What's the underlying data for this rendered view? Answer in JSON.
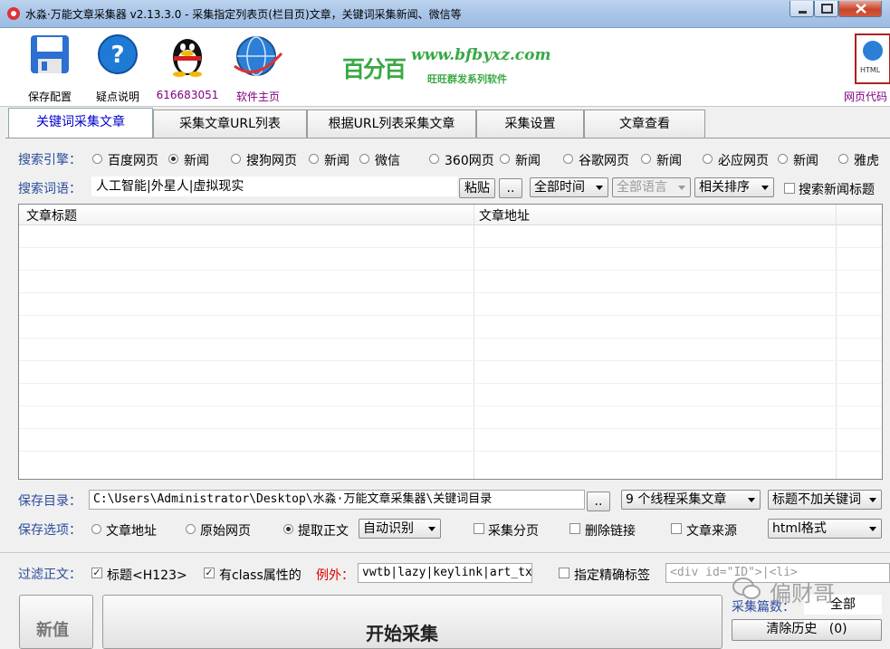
{
  "window": {
    "title": "水淼·万能文章采集器 v2.13.3.0 - 采集指定列表页(栏目页)文章，关键词采集新闻、微信等"
  },
  "toolbar": {
    "save_config": "保存配置",
    "help": "疑点说明",
    "qq": "616683051",
    "homepage": "软件主页",
    "logo_big": "百分百",
    "logo_url": "www.bfbyxz.com",
    "logo_sub": "旺旺群发系列软件",
    "html_label": "HTML",
    "web_code": "网页代码"
  },
  "tabs": [
    {
      "label": "关键词采集文章",
      "active": true
    },
    {
      "label": "采集文章URL列表",
      "active": false
    },
    {
      "label": "根据URL列表采集文章",
      "active": false
    },
    {
      "label": "采集设置",
      "active": false
    },
    {
      "label": "文章查看",
      "active": false
    }
  ],
  "search_engine": {
    "label": "搜索引擎：",
    "options": [
      {
        "label": "百度网页",
        "selected": false
      },
      {
        "label": "新闻",
        "selected": true
      },
      {
        "label": "搜狗网页",
        "selected": false
      },
      {
        "label": "新闻",
        "selected": false
      },
      {
        "label": "微信",
        "selected": false
      },
      {
        "label": "360网页",
        "selected": false
      },
      {
        "label": "新闻",
        "selected": false
      },
      {
        "label": "谷歌网页",
        "selected": false
      },
      {
        "label": "新闻",
        "selected": false
      },
      {
        "label": "必应网页",
        "selected": false
      },
      {
        "label": "新闻",
        "selected": false
      },
      {
        "label": "雅虎",
        "selected": false
      }
    ]
  },
  "search_terms": {
    "label": "搜索词语：",
    "value": "人工智能|外星人|虚拟现实",
    "paste": "粘贴",
    "more": "..",
    "time": "全部时间",
    "language": "全部语言",
    "sort": "相关排序",
    "news_title": "搜索新闻标题"
  },
  "list": {
    "columns": [
      "文章标题",
      "文章地址"
    ],
    "rows": []
  },
  "save_dir": {
    "label": "保存目录：",
    "value": "C:\\Users\\Administrator\\Desktop\\水淼·万能文章采集器\\关键词目录",
    "browse": "..",
    "threads": "9 个线程采集文章",
    "keyword_opt": "标题不加关键词"
  },
  "save_options": {
    "label": "保存选项：",
    "radios": [
      {
        "label": "文章地址",
        "selected": false
      },
      {
        "label": "原始网页",
        "selected": false
      },
      {
        "label": "提取正文",
        "selected": true
      }
    ],
    "extract_mode": "自动识别",
    "paging": {
      "label": "采集分页",
      "checked": false
    },
    "remove_links": {
      "label": "删除链接",
      "checked": false
    },
    "source": {
      "label": "文章来源",
      "checked": false
    },
    "format": "html格式"
  },
  "filter": {
    "label": "过滤正文：",
    "title_h": {
      "label": "标题<H123>",
      "checked": true
    },
    "class_attr": {
      "label": "有class属性的",
      "checked": true
    },
    "except_label": "例外：",
    "except_value": "vwtb|lazy|keylink|art_tx",
    "precise": {
      "label": "指定精确标签",
      "checked": false
    },
    "precise_value": "<div id=\"ID\">|<li>"
  },
  "bottom": {
    "new_button": "新值",
    "start_button": "开始采集",
    "collect_count_label": "采集篇数：",
    "collect_count_value": "全部",
    "clear_history": "清除历史",
    "clear_count": "(0)",
    "watermark": "偏财哥"
  },
  "colors": {
    "label_blue": "#2c4d9b",
    "tab_active_text": "#0000cc",
    "logo_green": "#39a845",
    "except_red": "#e00000"
  }
}
